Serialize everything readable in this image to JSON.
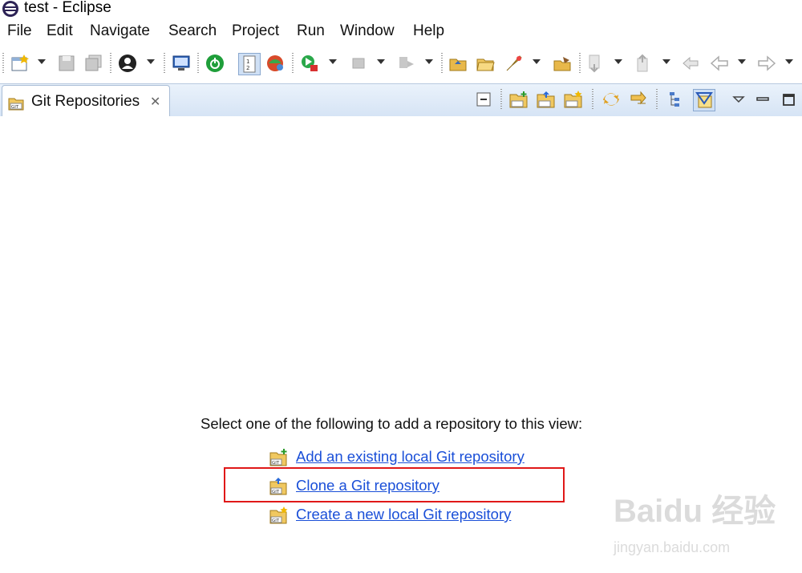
{
  "window": {
    "title": "test - Eclipse",
    "app_icon": "eclipse-icon"
  },
  "menubar": {
    "items": [
      "File",
      "Edit",
      "Navigate",
      "Search",
      "Project",
      "Run",
      "Window",
      "Help"
    ]
  },
  "toolbar": {
    "icons": [
      "new-wizard-icon",
      "save-icon",
      "save-all-icon",
      "user-icon",
      "console-icon",
      "spring-boot-icon",
      "line-numbers-icon",
      "debug-icon",
      "run-icon",
      "stop-icon",
      "step-icon",
      "open-type-icon",
      "open-folder-icon",
      "task-icon",
      "open-resource-icon",
      "next-annotation-icon",
      "previous-annotation-icon",
      "last-edit-location-icon",
      "back-icon",
      "forward-icon"
    ]
  },
  "view": {
    "tab_label": "Git Repositories",
    "tab_icon": "git-repositories-icon",
    "toolbar_icons": [
      "collapse-all-icon",
      "add-repository-icon",
      "clone-repository-icon",
      "create-repository-icon",
      "link-with-selection-icon",
      "refresh-icon",
      "hierarchical-layout-icon",
      "show-filter-icon",
      "view-menu-icon",
      "minimize-icon",
      "maximize-icon"
    ]
  },
  "content": {
    "instruction": "Select one of the following to add a repository to this view:",
    "links": [
      {
        "label": "Add an existing local Git repository",
        "icon": "git-add-icon"
      },
      {
        "label": "Clone a Git repository",
        "icon": "git-clone-icon"
      },
      {
        "label": "Create a new local Git repository",
        "icon": "git-create-icon"
      }
    ]
  },
  "watermark": {
    "brand": "Baidu 经验",
    "url": "jingyan.baidu.com"
  },
  "colors": {
    "link": "#1a4fd8",
    "highlight": "#e01818",
    "viewbar": "#d6e4f5"
  }
}
